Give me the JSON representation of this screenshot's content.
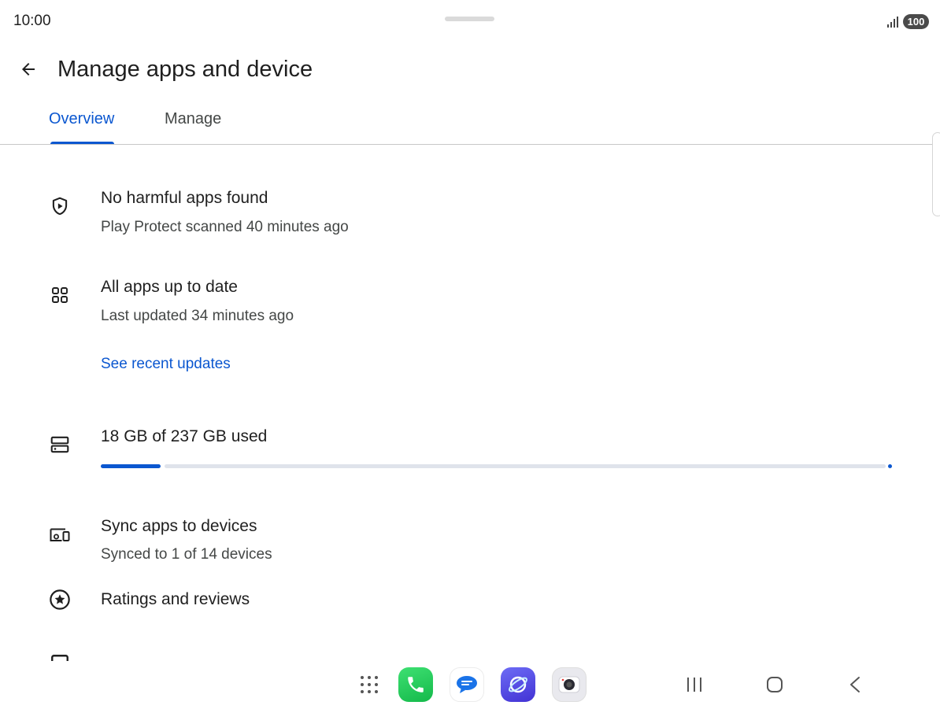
{
  "status_bar": {
    "time": "10:00",
    "battery": "100"
  },
  "header": {
    "title": "Manage apps and device"
  },
  "tabs": [
    {
      "label": "Overview",
      "selected": true
    },
    {
      "label": "Manage",
      "selected": false
    }
  ],
  "overview": {
    "protect": {
      "icon": "shield-play-icon",
      "title": "No harmful apps found",
      "subtitle": "Play Protect scanned 40 minutes ago"
    },
    "updates": {
      "icon": "apps-grid-icon",
      "title": "All apps up to date",
      "subtitle": "Last updated 34 minutes ago",
      "link": "See recent updates"
    },
    "storage": {
      "icon": "storage-icon",
      "title": "18 GB of 237 GB used",
      "used_gb": 18,
      "total_gb": 237
    },
    "sync": {
      "icon": "devices-icon",
      "title": "Sync apps to devices",
      "subtitle": "Synced to 1 of 14 devices"
    },
    "ratings": {
      "icon": "star-circle-icon",
      "title": "Ratings and reviews"
    }
  },
  "colors": {
    "accent": "#0b57d0",
    "text_primary": "#1f1f1f",
    "text_secondary": "#444746"
  },
  "navigation": {
    "dock": [
      "apps-grid-icon",
      "phone-app-icon",
      "messages-app-icon",
      "internet-app-icon",
      "camera-app-icon"
    ],
    "buttons": [
      "recents-icon",
      "home-icon",
      "back-icon"
    ]
  }
}
